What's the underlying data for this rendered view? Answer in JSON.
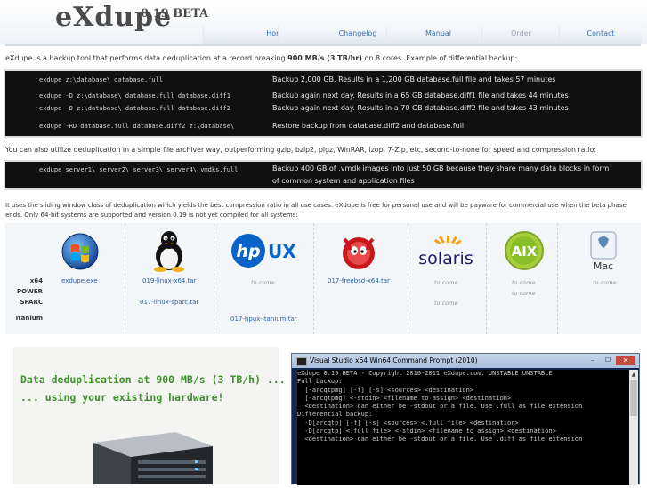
{
  "header": {
    "logo": "eXdupe",
    "version": "0.19 BETA",
    "nav": [
      {
        "label": "Home",
        "enabled": true
      },
      {
        "label": "Changelog",
        "enabled": true
      },
      {
        "label": "Manual",
        "enabled": true
      },
      {
        "label": "Order",
        "enabled": false
      },
      {
        "label": "Contact",
        "enabled": true
      }
    ]
  },
  "intro": {
    "before": "eXdupe is a backup tool that performs data deduplication at a record breaking ",
    "bold": "900 MB/s (3 TB/hr)",
    "after": " on 8 cores. Example of differential backup:"
  },
  "diff_examples": [
    {
      "cmd": "exdupe z:\\database\\ database.full",
      "desc": "Backup 2,000 GB. Results in a 1,200 GB database.full file and takes 57 minutes"
    },
    {
      "cmd": "exdupe -D z:\\database\\ database.full database.diff1",
      "desc": "Backup again next day. Results in a 65 GB database.diff1 file and takes 44 minutes"
    },
    {
      "cmd": "exdupe -D z:\\database\\ database.full database.diff2",
      "desc": "Backup again next day. Results in a 70 GB database.diff2 file and takes 43 minutes"
    },
    {
      "cmd": "exdupe -RD database.full database.diff2 z:\\database\\",
      "desc": "Restore backup from database.diff2 and database.full"
    }
  ],
  "archiver_text": "You can also utilize deduplication in a simple file archiver way, outperforming gzip, bzip2, pigz, WinRAR, lzop, 7-Zip, etc, second-to-none for speed and compression ratio:",
  "archiver_example": {
    "cmd": "exdupe server1\\ server2\\ server3\\ server4\\ vmdks.full",
    "desc1": "Backup 400 GB of .vmdk images into just 50 GB because they share many data blocks in form",
    "desc2": "of common system and application files"
  },
  "window_text_1": "It uses the sliding window class of deduplication which yields the best compression ratio in all use cases. eXdupe is free for personal use and will be payware for commercial use when the beta phase",
  "window_text_2": "ends. Only 64-bit systems are supported and version 0.19 is not yet compiled for all systems:",
  "platforms": {
    "row_labels": [
      "x64",
      "POWER",
      "SPARC",
      "Itanium"
    ],
    "downloads": {
      "windows_x64": "exdupe.exe",
      "linux_x64": "019-linux-x64.tar",
      "linux_sparc": "017-linux-sparc.tar",
      "hpux_itanium": "017-hpux-itanium.tar",
      "freebsd_x64": "017-freebsd-x64.tar",
      "to_come": "to come"
    },
    "logos": {
      "hpux_hp": "hp",
      "hpux_ux": "UX",
      "solaris": "solaris",
      "aix": "AIX",
      "mac": "Mac"
    }
  },
  "banner": {
    "line1": "Data deduplication at 900 MB/s (3 TB/h) ...",
    "line2": "... using your existing hardware!"
  },
  "console": {
    "title": "Visual Studio x64 Win64 Command Prompt (2010)",
    "lines": [
      "eXdupe 0.19 BETA - Copyright 2010-2011 eXdupe.com. UNSTABLE UNSTABLE",
      "",
      "Full backup:",
      "  [-arcqtpmg] [-f] [-s] <sources> <destination>",
      "  [-arcqtpmg] <-stdin> <filename to assign> <destination>",
      "",
      "  <destination> can either be -stdout or a file. Use .full as file extension",
      "",
      "Differential backup:",
      "  -D[arcqtp] [-f] [-s] <sources> <.full file> <destination>",
      "  -D[arcqtp] <.full file> <-stdin> <filename to assign> <destination>",
      "",
      "  <destination> can either be -stdout or a file. Use .diff as file extension"
    ]
  }
}
